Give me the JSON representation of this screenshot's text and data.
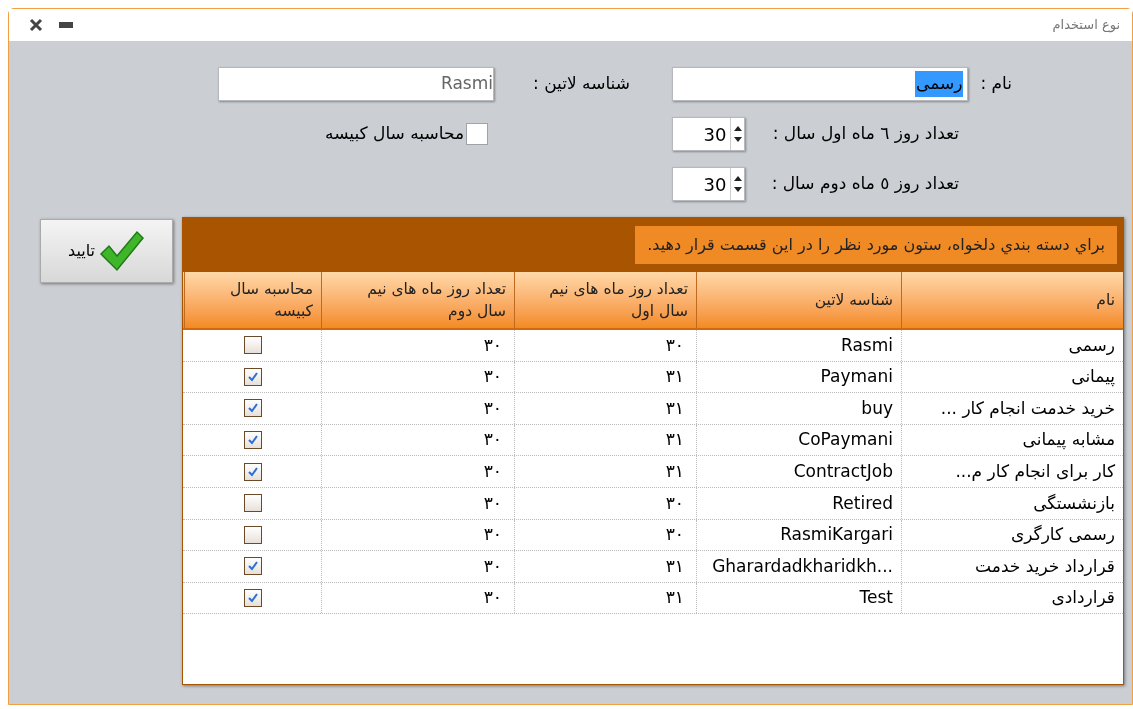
{
  "window": {
    "title": "نوع استخدام"
  },
  "form": {
    "name": {
      "label": "نام :",
      "value": "رسمی",
      "highlighted": true
    },
    "latin_id": {
      "label": "شناسه لاتین :",
      "value": "Rasmi"
    },
    "days_first_half": {
      "label": "تعداد روز ٦ ماه اول سال :",
      "value": "30"
    },
    "days_second_half": {
      "label": "تعداد روز ٥ ماه دوم سال :",
      "value": "30"
    },
    "leap_year": {
      "label": "محاسبه سال کبیسه",
      "checked": false
    }
  },
  "confirm_button": "تایید",
  "grid": {
    "group_hint": "براي دسته بندي دلخواه، ستون مورد نظر را در اين قسمت قرار دهيد.",
    "columns": [
      "نام",
      "شناسه لاتین",
      "تعداد روز ماه های نیم سال اول",
      "تعداد روز ماه های نیم سال دوم",
      "محاسبه سال کبیسه"
    ],
    "rows": [
      {
        "name": "رسمی",
        "latin": "Rasmi",
        "first_half": "۳۰",
        "second_half": "۳۰",
        "leap": false
      },
      {
        "name": "پیمانی",
        "latin": "Paymani",
        "first_half": "۳۱",
        "second_half": "۳۰",
        "leap": true
      },
      {
        "name": "خرید خدمت انجام کار ...",
        "latin": "buy",
        "first_half": "۳۱",
        "second_half": "۳۰",
        "leap": true
      },
      {
        "name": "مشابه پیمانی",
        "latin": "CoPaymani",
        "first_half": "۳۱",
        "second_half": "۳۰",
        "leap": true
      },
      {
        "name": "کار برای انجام کار م...",
        "latin": "ContractJob",
        "first_half": "۳۱",
        "second_half": "۳۰",
        "leap": true
      },
      {
        "name": "بازنشستگی",
        "latin": "Retired",
        "first_half": "۳۰",
        "second_half": "۳۰",
        "leap": false
      },
      {
        "name": "رسمی کارگری",
        "latin": "RasmiKargari",
        "first_half": "۳۰",
        "second_half": "۳۰",
        "leap": false
      },
      {
        "name": "قرارداد خرید خدمت",
        "latin": "Gharardadkharidkh...",
        "first_half": "۳۱",
        "second_half": "۳۰",
        "leap": true
      },
      {
        "name": "قراردادی",
        "latin": "Test",
        "first_half": "۳۱",
        "second_half": "۳۰",
        "leap": true
      }
    ]
  }
}
